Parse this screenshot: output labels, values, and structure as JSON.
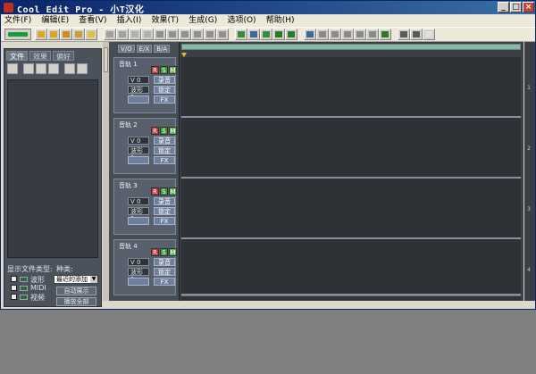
{
  "window": {
    "title": "Cool Edit Pro  - 小T汉化"
  },
  "titlebar_buttons": {
    "minimize": "_",
    "maximize": "□",
    "close": "×"
  },
  "menu": [
    "文件(F)",
    "编辑(E)",
    "查看(V)",
    "插入(I)",
    "效果(T)",
    "生成(G)",
    "选项(O)",
    "帮助(H)"
  ],
  "toolbar_icons": [
    "open-icon",
    "save-icon",
    "cut-icon",
    "copy-icon",
    "paste-icon",
    "undo-icon",
    "redo-icon",
    "zoom-icon",
    "loop-icon",
    "mix-icon",
    "record-icon",
    "metronome-icon",
    "wave-icon",
    "envelope-icon",
    "pan-icon",
    "pencil-icon",
    "select-icon",
    "time-icon",
    "cue-icon",
    "fx-icon",
    "rack-icon",
    "dsp-icon",
    "bus-icon",
    "marker-icon",
    "settings-icon",
    "help-icon"
  ],
  "left_panel": {
    "tabs": [
      "文件",
      "效果",
      "偏好"
    ],
    "file_types_label": "显示文件类型:",
    "types": [
      "波形",
      "MIDI",
      "视频"
    ],
    "sort_label": "种类:",
    "sort_value": "最近的添加",
    "buttons": [
      "自动展示",
      "播放全部"
    ]
  },
  "track_panel": {
    "tabs": [
      "V/O",
      "E/X",
      "B/A"
    ]
  },
  "tracks": [
    {
      "name": "音轨 1",
      "rsm": [
        "R",
        "S",
        "M"
      ],
      "volume": "V 0",
      "pan": "录音",
      "output": "波形 1",
      "lock": "锁定",
      "effect": "FX"
    },
    {
      "name": "音轨 2",
      "rsm": [
        "R",
        "S",
        "M"
      ],
      "volume": "V 0",
      "pan": "录音",
      "output": "波形 1",
      "lock": "锁定",
      "effect": "FX"
    },
    {
      "name": "音轨 3",
      "rsm": [
        "R",
        "S",
        "M"
      ],
      "volume": "V 0",
      "pan": "录音",
      "output": "波形 1",
      "lock": "锁定",
      "effect": "FX"
    },
    {
      "name": "音轨 4",
      "rsm": [
        "R",
        "S",
        "M"
      ],
      "volume": "V 0",
      "pan": "录音",
      "output": "波形 1",
      "lock": "锁定",
      "effect": "FX"
    }
  ],
  "right_markers": [
    "1",
    "2",
    "3",
    "4"
  ],
  "colors": {
    "r_button": "#c03a3a",
    "s_button": "#3a9a3a",
    "m_button": "#5fae52",
    "overview": "#8ab8a8",
    "cursor": "#e6c020"
  }
}
